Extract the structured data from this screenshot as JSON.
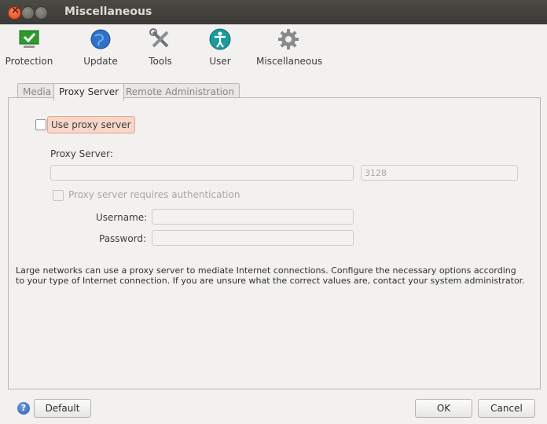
{
  "window": {
    "title": "Miscellaneous"
  },
  "toolbar": {
    "items": [
      {
        "label": "Protection",
        "icon": "monitor-check-icon"
      },
      {
        "label": "Update",
        "icon": "globe-icon"
      },
      {
        "label": "Tools",
        "icon": "tools-icon"
      },
      {
        "label": "User",
        "icon": "user-accessibility-icon"
      },
      {
        "label": "Miscellaneous",
        "icon": "gear-icon"
      }
    ]
  },
  "tabs": [
    {
      "label": "Media",
      "active": false
    },
    {
      "label": "Proxy Server",
      "active": true
    },
    {
      "label": "Remote Administration",
      "active": false
    }
  ],
  "proxy": {
    "use_proxy_label": "Use proxy server",
    "use_proxy_checked": false,
    "server_label": "Proxy Server:",
    "server_value": "",
    "port_value": "3128",
    "auth_label": "Proxy server requires authentication",
    "auth_checked": false,
    "username_label": "Username:",
    "username_value": "",
    "password_label": "Password:",
    "password_value": "",
    "description": "Large networks can use a proxy server to mediate Internet connections. Configure the necessary options according to your type of Internet connection. If you are unsure what the correct values are, contact your system administrator."
  },
  "footer": {
    "default_label": "Default",
    "ok_label": "OK",
    "cancel_label": "Cancel"
  },
  "colors": {
    "titlebar": "#3c3b37",
    "highlight": "#f6d7c9",
    "close": "#e0421a"
  }
}
